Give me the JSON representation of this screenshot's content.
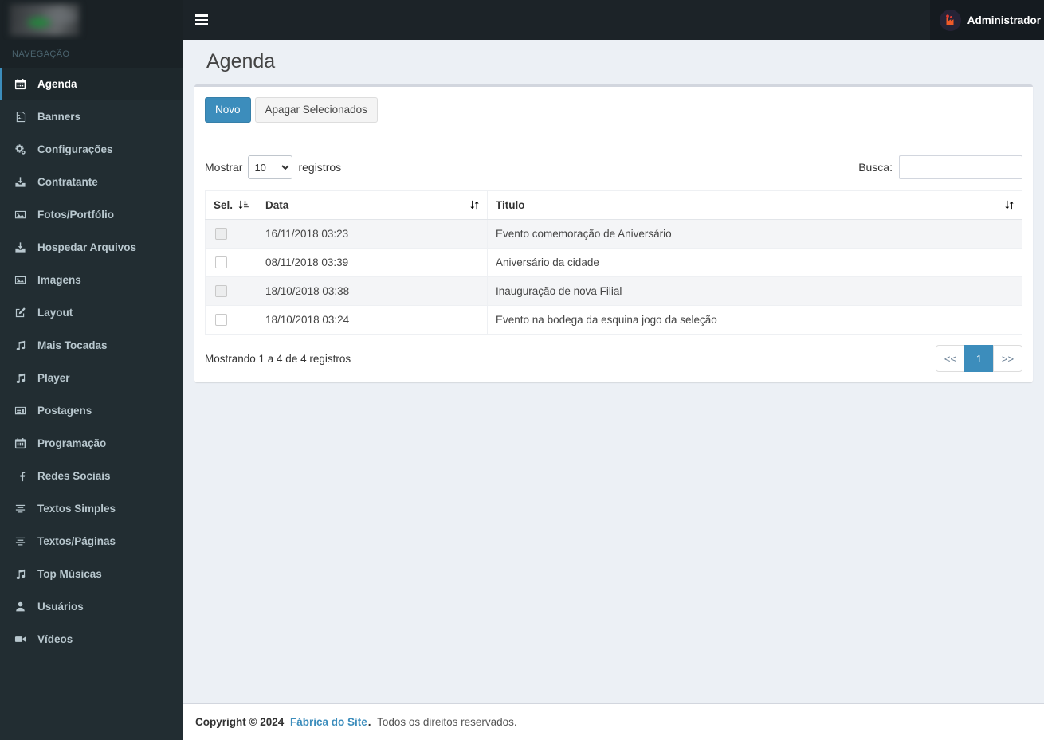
{
  "colors": {
    "accent": "#3c8dbc",
    "sidebar_bg": "#222d32",
    "navbar_bg": "#1c2328"
  },
  "navbar": {
    "user": {
      "name": "Administrador"
    }
  },
  "sidebar": {
    "section_label": "NAVEGAÇÃO",
    "items": [
      {
        "label": "Agenda",
        "icon": "calendar",
        "active": true
      },
      {
        "label": "Banners",
        "icon": "file-image",
        "active": false
      },
      {
        "label": "Configurações",
        "icon": "gears",
        "active": false
      },
      {
        "label": "Contratante",
        "icon": "download",
        "active": false
      },
      {
        "label": "Fotos/Portfólio",
        "icon": "image",
        "active": false
      },
      {
        "label": "Hospedar Arquivos",
        "icon": "download",
        "active": false
      },
      {
        "label": "Imagens",
        "icon": "image",
        "active": false
      },
      {
        "label": "Layout",
        "icon": "edit",
        "active": false
      },
      {
        "label": "Mais Tocadas",
        "icon": "music",
        "active": false
      },
      {
        "label": "Player",
        "icon": "music",
        "active": false
      },
      {
        "label": "Postagens",
        "icon": "newspaper",
        "active": false
      },
      {
        "label": "Programação",
        "icon": "calendar",
        "active": false
      },
      {
        "label": "Redes Sociais",
        "icon": "facebook",
        "active": false
      },
      {
        "label": "Textos Simples",
        "icon": "align",
        "active": false
      },
      {
        "label": "Textos/Páginas",
        "icon": "align",
        "active": false
      },
      {
        "label": "Top Músicas",
        "icon": "music",
        "active": false
      },
      {
        "label": "Usuários",
        "icon": "user",
        "active": false
      },
      {
        "label": "Vídeos",
        "icon": "video",
        "active": false
      }
    ]
  },
  "page": {
    "title": "Agenda"
  },
  "toolbar": {
    "new_label": "Novo",
    "delete_label": "Apagar Selecionados"
  },
  "table_controls": {
    "show_label": "Mostrar",
    "page_size": "10",
    "records_label": "registros",
    "search_label": "Busca:",
    "search_value": ""
  },
  "table": {
    "columns": [
      "Sel.",
      "Data",
      "Titulo"
    ],
    "rows": [
      {
        "date": "16/11/2018 03:23",
        "title": "Evento comemoração de Aniversário"
      },
      {
        "date": "08/11/2018 03:39",
        "title": "Aniversário da cidade"
      },
      {
        "date": "18/10/2018 03:38",
        "title": "Inauguração de nova Filial"
      },
      {
        "date": "18/10/2018 03:24",
        "title": "Evento na bodega da esquina jogo da seleção"
      }
    ]
  },
  "pagination": {
    "info": "Mostrando 1 a 4 de 4 registros",
    "prev": "<<",
    "current": "1",
    "next": ">>"
  },
  "footer": {
    "bold": "Copyright © 2024",
    "link": "Fábrica do Site",
    "dot": ".",
    "rest": "Todos os direitos reservados."
  }
}
